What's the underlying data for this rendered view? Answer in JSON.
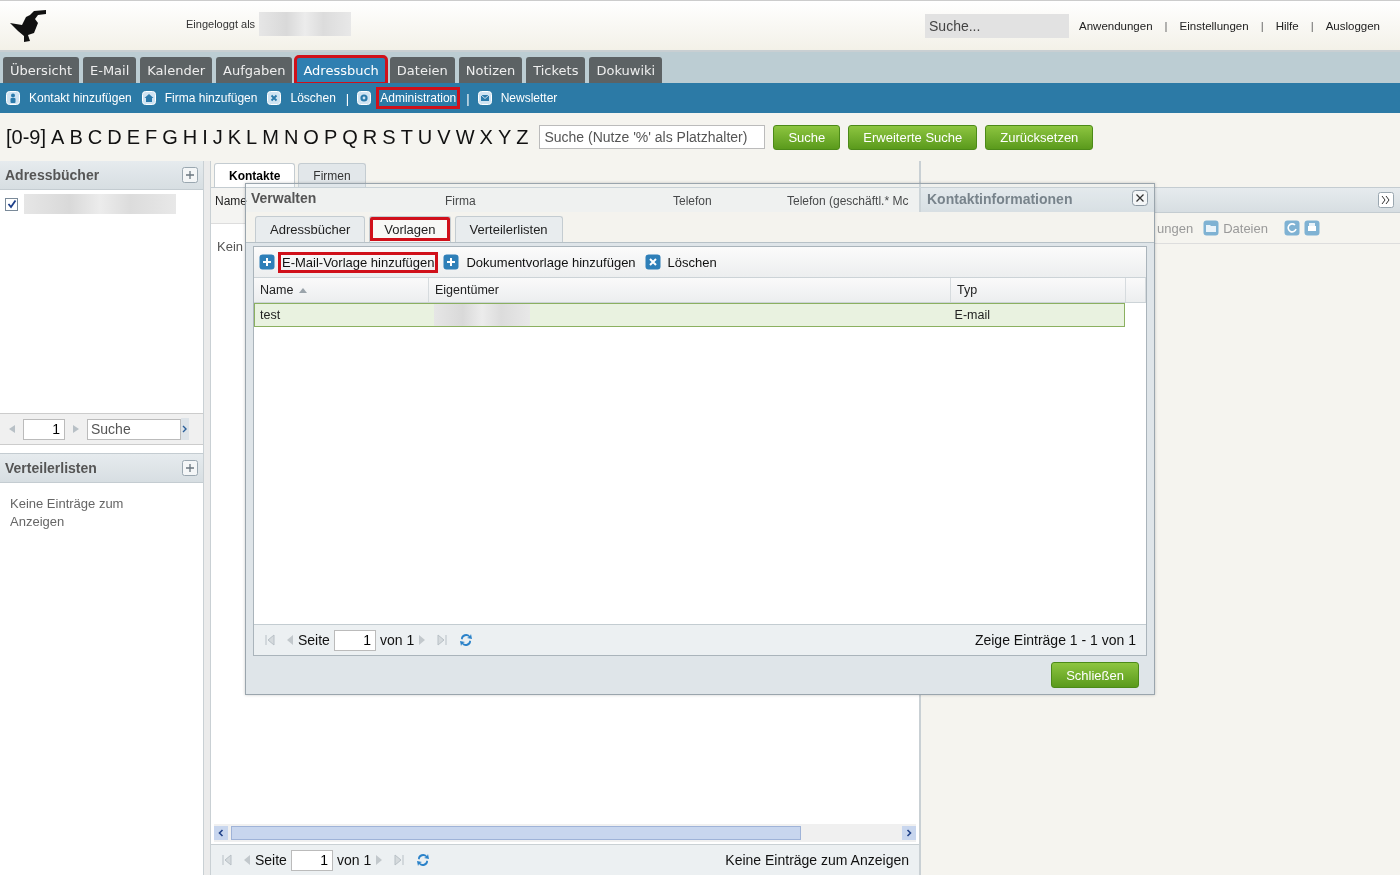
{
  "header": {
    "logged_in_label": "Eingeloggt als",
    "search": {
      "placeholder": "Suche..."
    },
    "links": [
      {
        "kind": "link",
        "text": "Anwendungen"
      },
      {
        "kind": "separator",
        "text": "|"
      },
      {
        "kind": "link",
        "text": "Einstellungen"
      },
      {
        "kind": "separator",
        "text": "|"
      },
      {
        "kind": "link",
        "text": "Hilfe"
      },
      {
        "kind": "separator",
        "text": "|"
      },
      {
        "kind": "link",
        "text": "Ausloggen"
      }
    ]
  },
  "nav_tabs": [
    {
      "label": "Übersicht",
      "selected": false,
      "highlighted": false
    },
    {
      "label": "E-Mail",
      "selected": false,
      "highlighted": false
    },
    {
      "label": "Kalender",
      "selected": false,
      "highlighted": false
    },
    {
      "label": "Aufgaben",
      "selected": false,
      "highlighted": false
    },
    {
      "label": "Adressbuch",
      "selected": true,
      "highlighted": true
    },
    {
      "label": "Dateien",
      "selected": false,
      "highlighted": false
    },
    {
      "label": "Notizen",
      "selected": false,
      "highlighted": false
    },
    {
      "label": "Tickets",
      "selected": false,
      "highlighted": false
    },
    {
      "label": "Dokuwiki",
      "selected": false,
      "highlighted": false
    }
  ],
  "toolbar": [
    {
      "kind": "button",
      "label": "Kontakt hinzufügen",
      "highlighted": false
    },
    {
      "kind": "button",
      "label": "Firma hinzufügen",
      "highlighted": false
    },
    {
      "kind": "button",
      "label": "Löschen",
      "highlighted": false
    },
    {
      "kind": "separator",
      "label": "|"
    },
    {
      "kind": "button",
      "label": "Administration",
      "highlighted": true
    },
    {
      "kind": "separator",
      "label": "|"
    },
    {
      "kind": "button",
      "label": "Newsletter",
      "highlighted": false
    }
  ],
  "alphabet": [
    "[0-9]",
    "A",
    "B",
    "C",
    "D",
    "E",
    "F",
    "G",
    "H",
    "I",
    "J",
    "K",
    "L",
    "M",
    "N",
    "O",
    "P",
    "Q",
    "R",
    "S",
    "T",
    "U",
    "V",
    "W",
    "X",
    "Y",
    "Z"
  ],
  "search_bar": {
    "placeholder": "Suche (Nutze '%' als Platzhalter)",
    "buttons": [
      "Suche",
      "Erweiterte Suche",
      "Zurücksetzen"
    ]
  },
  "sidebar": {
    "address_books": {
      "title": "Adressbücher",
      "items": [
        {
          "checked": true
        }
      ],
      "paging": {
        "page": "1",
        "search_placeholder": "Suche"
      }
    },
    "distribution_lists": {
      "title": "Verteilerlisten",
      "empty_text": "Keine Einträge zum Anzeigen"
    }
  },
  "main": {
    "tabs": [
      {
        "label": "Kontakte",
        "selected": true
      },
      {
        "label": "Firmen",
        "selected": false
      }
    ],
    "columns": [
      "Name",
      "Firma",
      "Telefon",
      "Telefon (geschäftl.* Mc"
    ],
    "empty_text": "Kein",
    "paging": {
      "page_label": "Seite",
      "page": "1",
      "of": "von 1",
      "status": "Keine Einträge zum Anzeigen"
    }
  },
  "details_panel": {
    "title": "Kontaktinformationen",
    "toolbar": [
      "ungen",
      "Dateien"
    ]
  },
  "dialog": {
    "title": "Verwalten",
    "tabs": [
      {
        "label": "Adressbücher",
        "selected": false,
        "highlighted": false
      },
      {
        "label": "Vorlagen",
        "selected": true,
        "highlighted": true
      },
      {
        "label": "Verteilerlisten",
        "selected": false,
        "highlighted": false
      }
    ],
    "toolbar": [
      {
        "label": "E-Mail-Vorlage hinzufügen",
        "highlighted": true
      },
      {
        "label": "Dokumentvorlage hinzufügen",
        "highlighted": false
      },
      {
        "label": "Löschen",
        "highlighted": false
      }
    ],
    "columns": [
      {
        "label": "Name",
        "sorted": true
      },
      {
        "label": "Eigentümer",
        "sorted": false
      },
      {
        "label": "Typ",
        "sorted": false
      }
    ],
    "rows": [
      {
        "name": "test",
        "type": "E-mail",
        "selected": true
      }
    ],
    "paging": {
      "page_label": "Seite",
      "page": "1",
      "of": "von 1",
      "status": "Zeige Einträge 1 - 1 von 1"
    },
    "close_button": "Schließen"
  }
}
